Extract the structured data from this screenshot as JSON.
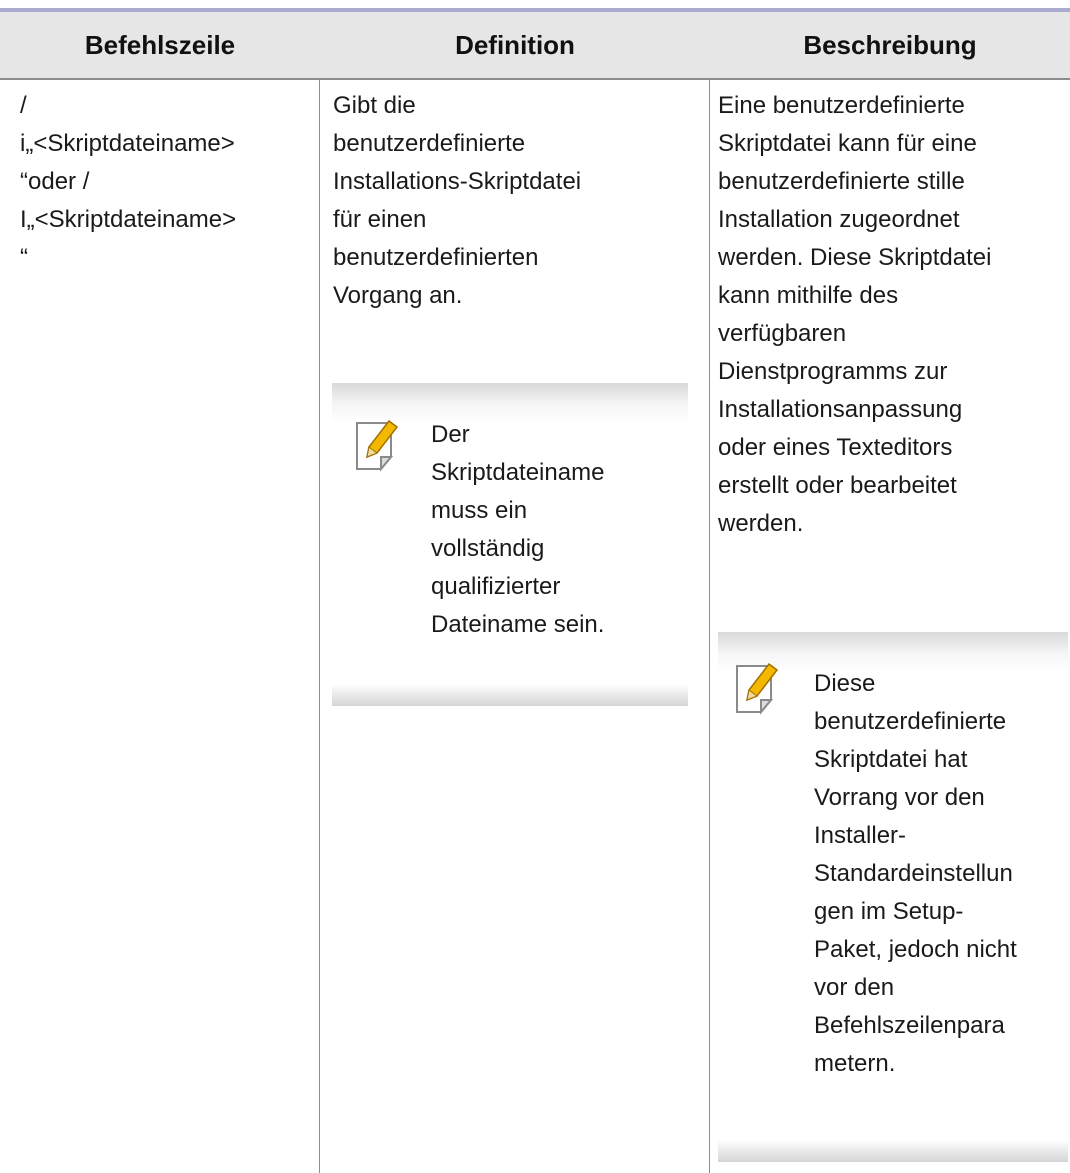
{
  "table": {
    "headers": [
      "Befehlszeile",
      "Definition",
      "Beschreibung"
    ],
    "row": {
      "command": "/\ni„<Skriptdateiname>\n“oder /\nI„<Skriptdateiname>\n“",
      "definition": "Gibt die\nbenutzerdefinierte\nInstallations-Skriptdatei\nfür einen\nbenutzerdefinierten\nVorgang an.",
      "definition_note": "Der\nSkriptdateiname\nmuss ein\nvollständig\nqualifizierter\nDateiname sein.",
      "description": "Eine benutzerdefinierte\nSkriptdatei kann für eine\nbenutzerdefinierte stille\nInstallation zugeordnet\nwerden. Diese Skriptdatei\nkann mithilfe des\nverfügbaren\nDienstprogramms zur\nInstallationsanpassung\noder eines Texteditors\nerstellt oder bearbeitet\nwerden.",
      "description_note": "Diese\nbenutzerdefinierte\nSkriptdatei hat\nVorrang vor den\nInstaller-\nStandardeinstellun\ngen im Setup-\nPaket, jedoch nicht\nvor den\nBefehlszeilenpara\nmetern."
    }
  },
  "icons": {
    "note": "note-pencil-icon"
  },
  "colors": {
    "header_bg": "#e6e6e6",
    "top_rule": "#a9abcf",
    "pencil": "#f5b800"
  }
}
